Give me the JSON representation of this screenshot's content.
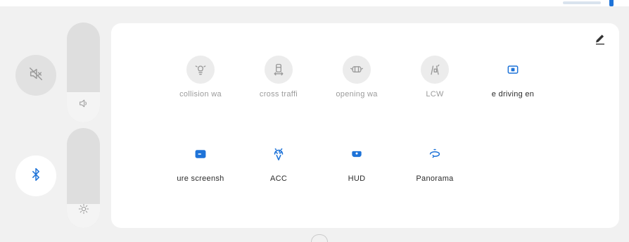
{
  "colors": {
    "accent": "#1e73d8",
    "inactive_icon": "#9a9a9a",
    "active_label": "#2b2b2b",
    "inactive_label": "#9b9b9b",
    "panel_bg": "#ffffff",
    "screen_bg": "#f1f1f1"
  },
  "left_controls": {
    "mute": {
      "icon": "speaker-muted-icon",
      "active": false
    },
    "bluetooth": {
      "icon": "bluetooth-icon",
      "active": true
    },
    "volume_slider": {
      "icon": "speaker-icon",
      "level": 0.3
    },
    "brightness_slider": {
      "icon": "brightness-icon",
      "level": 0.24
    }
  },
  "panel": {
    "edit_icon": "pencil-icon",
    "rows": [
      [
        {
          "label": "collision wa",
          "icon": "collision-warning-icon",
          "active": false
        },
        {
          "label": "cross traffi",
          "icon": "cross-traffic-icon",
          "active": false
        },
        {
          "label": "opening wa",
          "icon": "door-opening-icon",
          "active": false
        },
        {
          "label": "LCW",
          "icon": "lane-change-icon",
          "active": false
        },
        {
          "label": "e driving en",
          "icon": "screen-icon",
          "active": true
        }
      ],
      [
        {
          "label": "ure screensh",
          "icon": "screenshot-icon",
          "active": true
        },
        {
          "label": "ACC",
          "icon": "acc-icon",
          "active": true
        },
        {
          "label": "HUD",
          "icon": "hud-icon",
          "active": true
        },
        {
          "label": "Panorama",
          "icon": "panorama-icon",
          "active": true
        }
      ]
    ]
  }
}
